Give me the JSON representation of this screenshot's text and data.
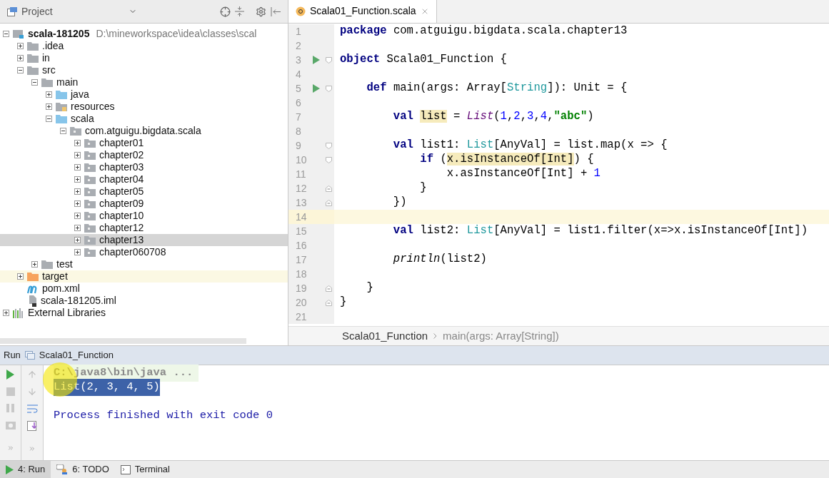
{
  "project_panel": {
    "title": "Project",
    "tree": [
      {
        "label": "scala-181205",
        "kind": "module",
        "path": "D:\\mineworkspace\\idea\\classes\\scal",
        "expanded": true,
        "selected": false,
        "children": [
          {
            "label": ".idea",
            "kind": "folder",
            "expanded": false,
            "selected": false
          },
          {
            "label": "in",
            "kind": "folder",
            "expanded": false,
            "selected": false
          },
          {
            "label": "src",
            "kind": "folder",
            "expanded": true,
            "selected": false,
            "children": [
              {
                "label": "main",
                "kind": "folder",
                "expanded": true,
                "selected": false,
                "children": [
                  {
                    "label": "java",
                    "kind": "source",
                    "expanded": false,
                    "selected": false
                  },
                  {
                    "label": "resources",
                    "kind": "resources",
                    "expanded": false,
                    "selected": false
                  },
                  {
                    "label": "scala",
                    "kind": "source",
                    "expanded": true,
                    "selected": false,
                    "children": [
                      {
                        "label": "com.atguigu.bigdata.scala",
                        "kind": "package",
                        "expanded": true,
                        "selected": false,
                        "children": [
                          {
                            "label": "chapter01",
                            "kind": "package",
                            "expanded": false,
                            "selected": false
                          },
                          {
                            "label": "chapter02",
                            "kind": "package",
                            "expanded": false,
                            "selected": false
                          },
                          {
                            "label": "chapter03",
                            "kind": "package",
                            "expanded": false,
                            "selected": false
                          },
                          {
                            "label": "chapter04",
                            "kind": "package",
                            "expanded": false,
                            "selected": false
                          },
                          {
                            "label": "chapter05",
                            "kind": "package",
                            "expanded": false,
                            "selected": false
                          },
                          {
                            "label": "chapter09",
                            "kind": "package",
                            "expanded": false,
                            "selected": false
                          },
                          {
                            "label": "chapter10",
                            "kind": "package",
                            "expanded": false,
                            "selected": false
                          },
                          {
                            "label": "chapter12",
                            "kind": "package",
                            "expanded": false,
                            "selected": false
                          },
                          {
                            "label": "chapter13",
                            "kind": "package",
                            "expanded": false,
                            "selected": true
                          },
                          {
                            "label": "chapter060708",
                            "kind": "package",
                            "expanded": false,
                            "selected": false
                          }
                        ]
                      }
                    ]
                  }
                ]
              },
              {
                "label": "test",
                "kind": "folder",
                "expanded": false,
                "selected": false
              }
            ]
          },
          {
            "label": "target",
            "kind": "excluded",
            "expanded": false,
            "selected": false
          },
          {
            "label": "pom.xml",
            "kind": "maven",
            "selected": false
          },
          {
            "label": "scala-181205.iml",
            "kind": "iml",
            "selected": false
          }
        ]
      },
      {
        "label": "External Libraries",
        "kind": "libraries",
        "expanded": false,
        "selected": false
      }
    ]
  },
  "editor": {
    "tabs": [
      {
        "label": "Scala01_Function.scala",
        "selected": true
      }
    ],
    "lines": [
      {
        "number": "1",
        "tokens": [
          {
            "kind": "kw",
            "text": "package "
          },
          {
            "kind": "text",
            "text": "com.atguigu.bigdata.scala.chapter13"
          }
        ]
      },
      {
        "number": "2"
      },
      {
        "number": "3",
        "run": true,
        "fold_open": true,
        "tokens": [
          {
            "kind": "kw",
            "text": "object "
          },
          {
            "kind": "text",
            "text": "Scala01_Function {"
          }
        ]
      },
      {
        "number": "4"
      },
      {
        "number": "5",
        "run": true,
        "fold_open": true,
        "tokens": [
          {
            "kind": "kw",
            "text": "    def "
          },
          {
            "kind": "text",
            "text": "main(args: Array["
          },
          {
            "kind": "type",
            "text": "String"
          },
          {
            "kind": "text",
            "text": "]): Unit = {"
          }
        ]
      },
      {
        "number": "6"
      },
      {
        "number": "7",
        "tokens": [
          {
            "kind": "kw",
            "text": "        val "
          },
          {
            "kind": "ref",
            "text": "list"
          },
          {
            "kind": "text",
            "text": " = "
          },
          {
            "kind": "call",
            "text": "List"
          },
          {
            "kind": "text",
            "text": "("
          },
          {
            "kind": "num",
            "text": "1"
          },
          {
            "kind": "text",
            "text": ","
          },
          {
            "kind": "num",
            "text": "2"
          },
          {
            "kind": "text",
            "text": ","
          },
          {
            "kind": "num",
            "text": "3"
          },
          {
            "kind": "text",
            "text": ","
          },
          {
            "kind": "num",
            "text": "4"
          },
          {
            "kind": "text",
            "text": ","
          },
          {
            "kind": "str",
            "text": "\"abc\""
          },
          {
            "kind": "text",
            "text": ")"
          }
        ]
      },
      {
        "number": "8"
      },
      {
        "number": "9",
        "fold_open": true,
        "tokens": [
          {
            "kind": "kw",
            "text": "        val "
          },
          {
            "kind": "text",
            "text": "list1: "
          },
          {
            "kind": "type",
            "text": "List"
          },
          {
            "kind": "text",
            "text": "[AnyVal] = list.map(x => {"
          }
        ]
      },
      {
        "number": "10",
        "fold_open": true,
        "tokens": [
          {
            "kind": "kw",
            "text": "            if "
          },
          {
            "kind": "text",
            "text": "("
          },
          {
            "kind": "ref",
            "text": "x.isInstanceOf[Int]"
          },
          {
            "kind": "text",
            "text": ") {"
          }
        ]
      },
      {
        "number": "11",
        "tokens": [
          {
            "kind": "text",
            "text": "                x.asInstanceOf[Int] + "
          },
          {
            "kind": "num",
            "text": "1"
          }
        ]
      },
      {
        "number": "12",
        "fold_close": true,
        "tokens": [
          {
            "kind": "text",
            "text": "            }"
          }
        ]
      },
      {
        "number": "13",
        "fold_close": true,
        "tokens": [
          {
            "kind": "text",
            "text": "        })"
          }
        ]
      },
      {
        "number": "14",
        "current": true
      },
      {
        "number": "15",
        "tokens": [
          {
            "kind": "kw",
            "text": "        val "
          },
          {
            "kind": "text",
            "text": "list2: "
          },
          {
            "kind": "type",
            "text": "List"
          },
          {
            "kind": "text",
            "text": "[AnyVal] = list1.filter(x=>x.isInstanceOf[Int])"
          }
        ]
      },
      {
        "number": "16"
      },
      {
        "number": "17",
        "tokens": [
          {
            "kind": "italic",
            "text": "        println"
          },
          {
            "kind": "text",
            "text": "(list2)"
          }
        ]
      },
      {
        "number": "18"
      },
      {
        "number": "19",
        "fold_close": true,
        "tokens": [
          {
            "kind": "text",
            "text": "    }"
          }
        ]
      },
      {
        "number": "20",
        "fold_close": true,
        "tokens": [
          {
            "kind": "text",
            "text": "}"
          }
        ]
      },
      {
        "number": "21"
      }
    ],
    "breadcrumb": [
      "Scala01_Function",
      "main(args: Array[String])"
    ]
  },
  "run_panel": {
    "label": "Run",
    "config": "Scala01_Function",
    "console": [
      {
        "kind": "command",
        "text": "C:\\java8\\bin\\java ..."
      },
      {
        "kind": "output",
        "text": "List(2, 3, 4, 5)",
        "selected": true
      },
      {
        "kind": "blank"
      },
      {
        "kind": "exit",
        "text": "Process finished with exit code 0"
      }
    ]
  },
  "tool_tabs": [
    {
      "label": "4: Run",
      "kind": "run",
      "selected": true
    },
    {
      "label": "6: TODO",
      "kind": "todo",
      "selected": false
    },
    {
      "label": "Terminal",
      "kind": "terminal",
      "selected": false
    }
  ]
}
